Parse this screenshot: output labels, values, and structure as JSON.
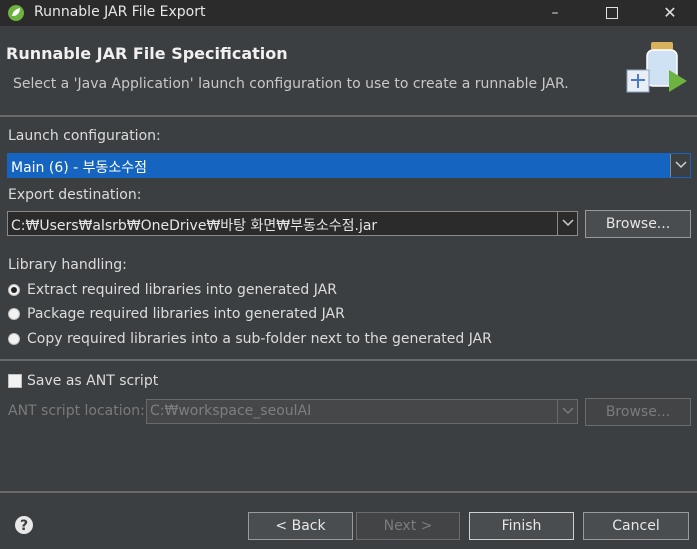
{
  "window": {
    "title": "Runnable JAR File Export",
    "controls": [
      "minimize",
      "maximize",
      "close"
    ]
  },
  "header": {
    "title": "Runnable JAR File Specification",
    "description": "Select a 'Java Application' launch configuration to use to create a runnable JAR."
  },
  "launch": {
    "label": "Launch configuration:",
    "selected": "Main (6) - 부동소수점"
  },
  "export": {
    "label": "Export destination:",
    "value": "C:₩Users₩alsrb₩OneDrive₩바탕 화면₩부동소수점.jar",
    "browse": "Browse..."
  },
  "library": {
    "label": "Library handling:",
    "options": [
      {
        "label": "Extract required libraries into generated JAR",
        "checked": true
      },
      {
        "label": "Package required libraries into generated JAR",
        "checked": false
      },
      {
        "label": "Copy required libraries into a sub-folder next to the generated JAR",
        "checked": false
      }
    ]
  },
  "ant": {
    "save_label": "Save as ANT script",
    "location_label": "ANT script location:",
    "location_value": "C:₩workspace_seoulAI",
    "browse": "Browse..."
  },
  "buttons": {
    "back": "< Back",
    "next": "Next >",
    "finish": "Finish",
    "cancel": "Cancel"
  },
  "colors": {
    "background": "#3c3f41",
    "titlebar": "#2b2b2b",
    "selection": "#1565c0",
    "spring_green": "#6db33f"
  }
}
